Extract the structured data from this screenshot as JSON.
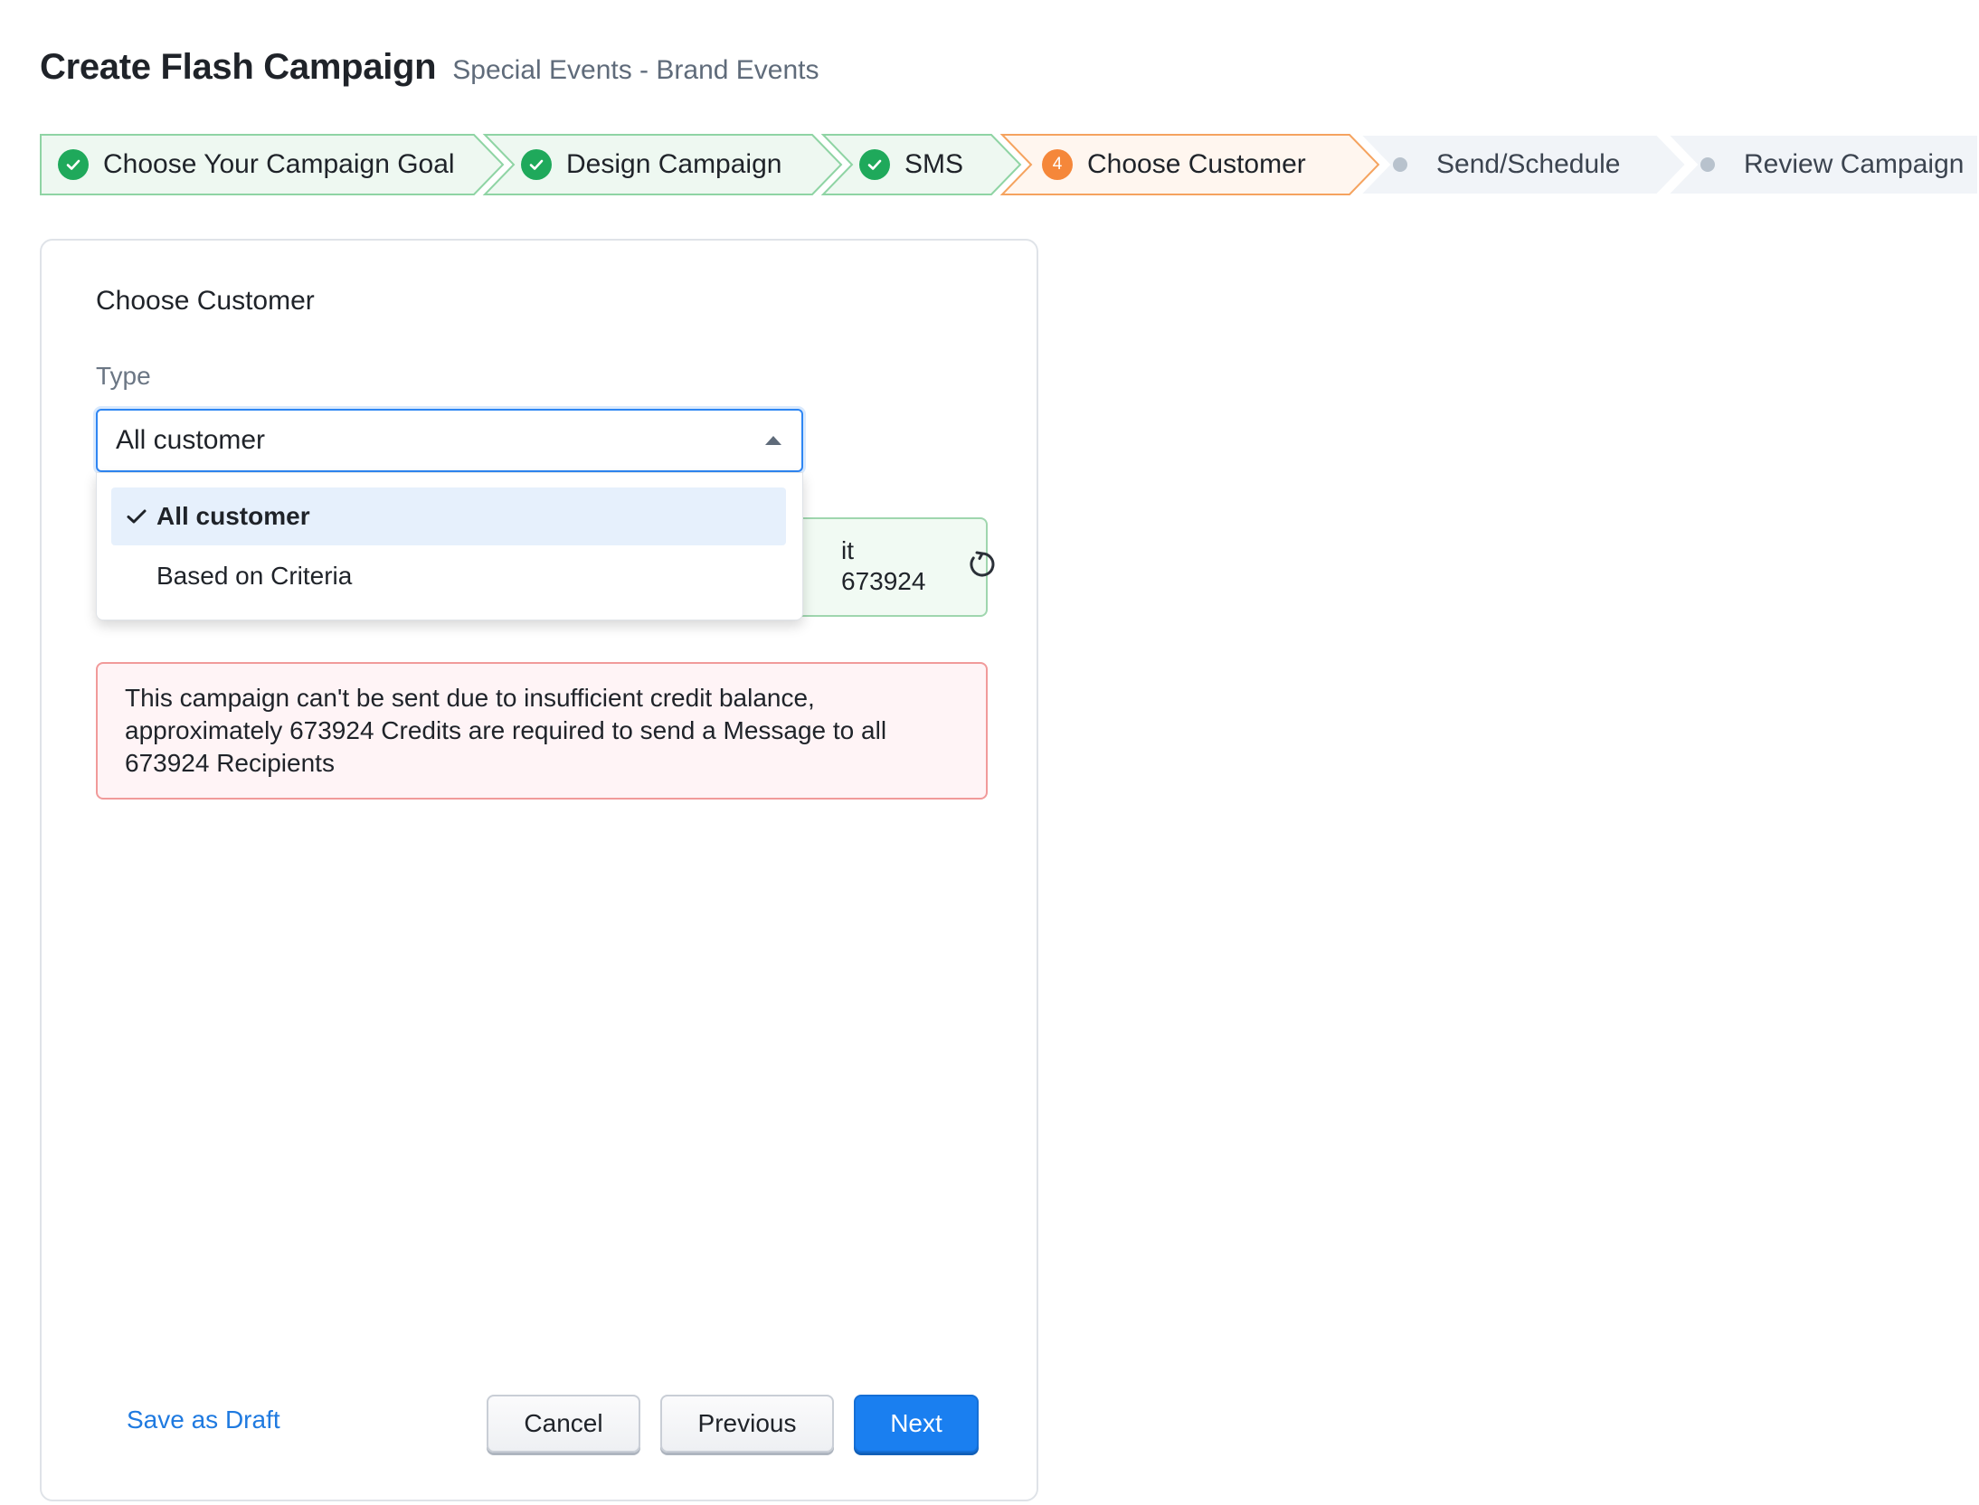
{
  "header": {
    "title": "Create Flash Campaign",
    "subtitle": "Special Events - Brand Events"
  },
  "stepper": {
    "steps": [
      {
        "label": "Choose Your Campaign Goal",
        "status": "completed"
      },
      {
        "label": "Design Campaign",
        "status": "completed"
      },
      {
        "label": "SMS",
        "status": "completed"
      },
      {
        "label": "Choose Customer",
        "status": "active",
        "number": "4"
      },
      {
        "label": "Send/Schedule",
        "status": "pending"
      },
      {
        "label": "Review Campaign",
        "status": "pending"
      }
    ],
    "colors": {
      "completed_fill": "#eef8f1",
      "completed_border": "#8fd4a4",
      "active_fill": "#fff6ef",
      "active_border": "#f5a35f",
      "pending_fill": "#f1f4f8"
    }
  },
  "card": {
    "section_title": "Choose Customer",
    "type_label": "Type",
    "select": {
      "value": "All customer",
      "options": [
        {
          "label": "All customer",
          "selected": true
        },
        {
          "label": "Based on Criteria",
          "selected": false
        }
      ]
    },
    "credit_box": {
      "line1_partial": "it",
      "line2_partial": "673924"
    },
    "error_message": "This campaign can't be sent due to insufficient credit balance, approximately 673924 Credits are required to send a Message to all 673924 Recipients"
  },
  "footer": {
    "save_draft": "Save as Draft",
    "cancel": "Cancel",
    "previous": "Previous",
    "next": "Next"
  }
}
